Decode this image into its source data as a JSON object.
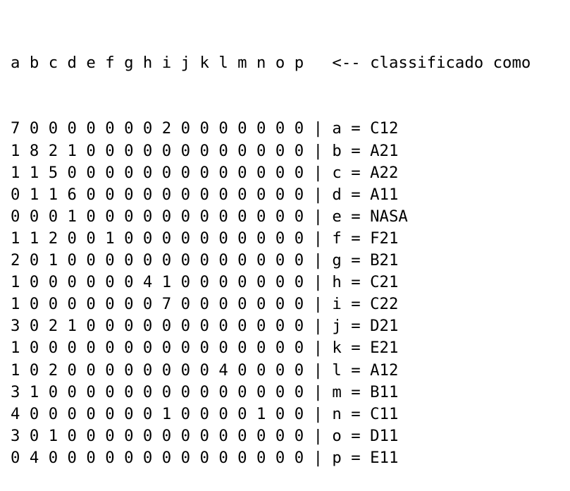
{
  "header": {
    "columns": [
      "a",
      "b",
      "c",
      "d",
      "e",
      "f",
      "g",
      "h",
      "i",
      "j",
      "k",
      "l",
      "m",
      "n",
      "o",
      "p"
    ],
    "caption": "<-- classificado como"
  },
  "rows": [
    {
      "values": [
        7,
        0,
        0,
        0,
        0,
        0,
        0,
        0,
        2,
        0,
        0,
        0,
        0,
        0,
        0,
        0
      ],
      "label": "a = C12"
    },
    {
      "values": [
        1,
        8,
        2,
        1,
        0,
        0,
        0,
        0,
        0,
        0,
        0,
        0,
        0,
        0,
        0,
        0
      ],
      "label": "b = A21"
    },
    {
      "values": [
        1,
        1,
        5,
        0,
        0,
        0,
        0,
        0,
        0,
        0,
        0,
        0,
        0,
        0,
        0,
        0
      ],
      "label": "c = A22"
    },
    {
      "values": [
        0,
        1,
        1,
        6,
        0,
        0,
        0,
        0,
        0,
        0,
        0,
        0,
        0,
        0,
        0,
        0
      ],
      "label": "d = A11"
    },
    {
      "values": [
        0,
        0,
        0,
        1,
        0,
        0,
        0,
        0,
        0,
        0,
        0,
        0,
        0,
        0,
        0,
        0
      ],
      "label": "e = NASA"
    },
    {
      "values": [
        1,
        1,
        2,
        0,
        0,
        1,
        0,
        0,
        0,
        0,
        0,
        0,
        0,
        0,
        0,
        0
      ],
      "label": "f = F21"
    },
    {
      "values": [
        2,
        0,
        1,
        0,
        0,
        0,
        0,
        0,
        0,
        0,
        0,
        0,
        0,
        0,
        0,
        0
      ],
      "label": "g = B21"
    },
    {
      "values": [
        1,
        0,
        0,
        0,
        0,
        0,
        0,
        4,
        1,
        0,
        0,
        0,
        0,
        0,
        0,
        0
      ],
      "label": "h = C21"
    },
    {
      "values": [
        1,
        0,
        0,
        0,
        0,
        0,
        0,
        0,
        7,
        0,
        0,
        0,
        0,
        0,
        0,
        0
      ],
      "label": "i = C22"
    },
    {
      "values": [
        3,
        0,
        2,
        1,
        0,
        0,
        0,
        0,
        0,
        0,
        0,
        0,
        0,
        0,
        0,
        0
      ],
      "label": "j = D21"
    },
    {
      "values": [
        1,
        0,
        0,
        0,
        0,
        0,
        0,
        0,
        0,
        0,
        0,
        0,
        0,
        0,
        0,
        0
      ],
      "label": "k = E21"
    },
    {
      "values": [
        1,
        0,
        2,
        0,
        0,
        0,
        0,
        0,
        0,
        0,
        0,
        4,
        0,
        0,
        0,
        0
      ],
      "label": "l = A12"
    },
    {
      "values": [
        3,
        1,
        0,
        0,
        0,
        0,
        0,
        0,
        0,
        0,
        0,
        0,
        0,
        0,
        0,
        0
      ],
      "label": "m = B11"
    },
    {
      "values": [
        4,
        0,
        0,
        0,
        0,
        0,
        0,
        0,
        1,
        0,
        0,
        0,
        0,
        1,
        0,
        0
      ],
      "label": "n = C11"
    },
    {
      "values": [
        3,
        0,
        1,
        0,
        0,
        0,
        0,
        0,
        0,
        0,
        0,
        0,
        0,
        0,
        0,
        0
      ],
      "label": "o = D11"
    },
    {
      "values": [
        0,
        4,
        0,
        0,
        0,
        0,
        0,
        0,
        0,
        0,
        0,
        0,
        0,
        0,
        0,
        0
      ],
      "label": "p = E11"
    }
  ],
  "separator": "|"
}
